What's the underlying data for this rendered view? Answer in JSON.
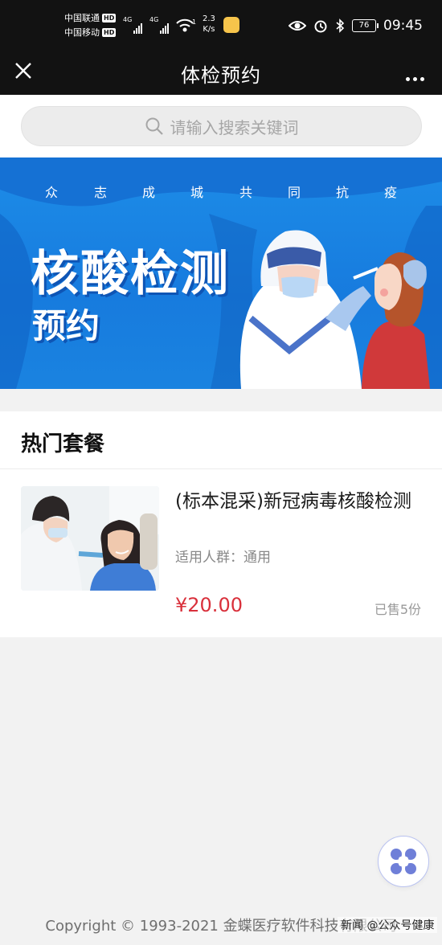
{
  "status_bar": {
    "carrier1": "中国联通",
    "carrier2": "中国移动",
    "hd": "HD",
    "net1": "4G",
    "net2": "4G",
    "wifi_badge": "1",
    "speed_value": "2.3",
    "speed_unit": "K/s",
    "battery": "76",
    "time": "09:45",
    "icons": [
      "eye-icon",
      "alarm-icon",
      "bluetooth-icon"
    ]
  },
  "nav": {
    "title": "体检预约",
    "close_icon": "close-icon",
    "more_icon": "more-icon"
  },
  "search": {
    "placeholder": "请输入搜索关键词"
  },
  "banner": {
    "slogan": [
      "众",
      "志",
      "成",
      "城",
      "共",
      "同",
      "抗",
      "疫"
    ],
    "title": "核酸检测",
    "subtitle": "预约"
  },
  "section": {
    "title": "热门套餐"
  },
  "product": {
    "name": "(标本混采)新冠病毒核酸检测",
    "tag": "适用人群：通用",
    "price": "¥20.00",
    "sold": "已售5份"
  },
  "footer": {
    "copyright": "Copyright © 1993-2021 金蝶医疗软件科技有限公司",
    "watermark": "新闻 @公众号健康"
  },
  "colors": {
    "accent_price": "#d9303b",
    "banner_blue": "#1a83e0",
    "topbar": "#121212"
  }
}
